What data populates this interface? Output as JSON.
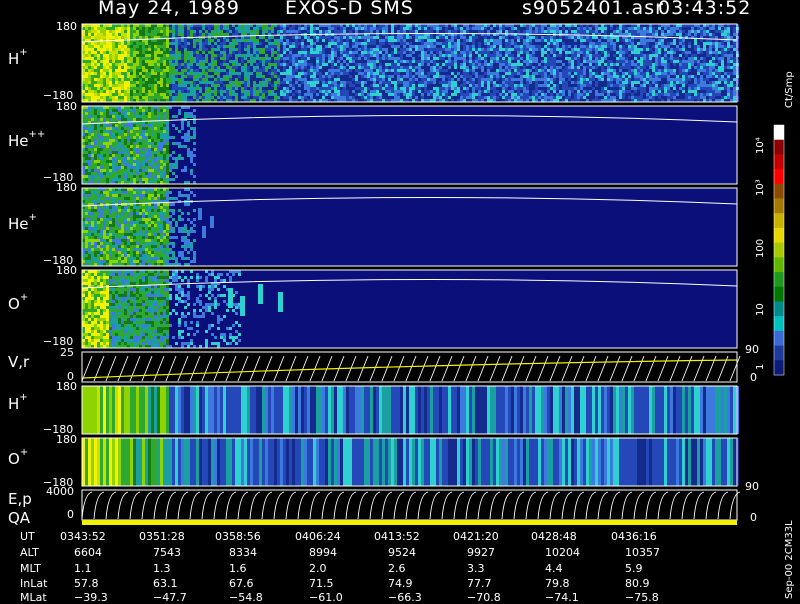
{
  "header": {
    "date": "May 24, 1989",
    "instrument": "EXOS-D SMS",
    "file": "s9052401.asr",
    "time": "03:43:52"
  },
  "panels": [
    {
      "id": "hplus",
      "species": "H",
      "charge": "+",
      "top_tick": "180",
      "bottom_tick": "−180"
    },
    {
      "id": "heplusplus",
      "species": "He",
      "charge": "++",
      "top_tick": "180",
      "bottom_tick": "−180"
    },
    {
      "id": "heplus",
      "species": "He",
      "charge": "+",
      "top_tick": "180",
      "bottom_tick": "−180"
    },
    {
      "id": "oplus",
      "species": "O",
      "charge": "+",
      "top_tick": "180",
      "bottom_tick": "−180"
    },
    {
      "id": "vr",
      "label": "V,r",
      "top_tick": "25",
      "bottom_tick": "0",
      "right_top": "90",
      "right_bottom": "0"
    },
    {
      "id": "hplus2",
      "species": "H",
      "charge": "+",
      "top_tick": "180",
      "bottom_tick": "−180"
    },
    {
      "id": "oplus2",
      "species": "O",
      "charge": "+",
      "top_tick": "180",
      "bottom_tick": "−180"
    },
    {
      "id": "ep",
      "label": "E,p",
      "label2": "QA",
      "top_tick": "4000",
      "bottom_tick": "0",
      "right_top": "90",
      "right_bottom": "0"
    }
  ],
  "colorbar": {
    "units": "Ct/Smp",
    "tick_labels": [
      "10⁴",
      "10³",
      "100",
      "10",
      "1"
    ],
    "colors": [
      "#ffffff",
      "#8b0000",
      "#c40000",
      "#ff0000",
      "#8b4a00",
      "#a67c00",
      "#c8b400",
      "#e6d800",
      "#a8c800",
      "#60b800",
      "#1e9a1e",
      "#007800",
      "#008a8a",
      "#00c0c0",
      "#3a6ad6",
      "#1e3a9a",
      "#0c1a78"
    ]
  },
  "footer": {
    "rows": [
      {
        "label": "UT",
        "values": [
          "0343:52",
          "0351:28",
          "0358:56",
          "0406:24",
          "0413:52",
          "0421:20",
          "0428:48",
          "0436:16"
        ]
      },
      {
        "label": "ALT",
        "values": [
          "6604",
          "7543",
          "8334",
          "8994",
          "9524",
          "9927",
          "10204",
          "10357"
        ]
      },
      {
        "label": "MLT",
        "values": [
          "1.1",
          "1.3",
          "1.6",
          "2.0",
          "2.6",
          "3.3",
          "4.4",
          "5.9"
        ]
      },
      {
        "label": "InLat",
        "values": [
          "57.8",
          "63.1",
          "67.6",
          "71.5",
          "74.9",
          "77.7",
          "79.8",
          "80.9"
        ]
      },
      {
        "label": "MLat",
        "values": [
          "−39.3",
          "−47.7",
          "−54.8",
          "−61.0",
          "−66.3",
          "−70.8",
          "−74.1",
          "−75.8"
        ]
      }
    ]
  },
  "version_label": "Sep-00 2CM33L",
  "chart_data": {
    "type": "heatmap",
    "title": "May 24, 1989   EXOS-D SMS",
    "x": [
      "0343:52",
      "0351:28",
      "0358:56",
      "0406:24",
      "0413:52",
      "0421:20",
      "0428:48",
      "0436:16"
    ],
    "panels": [
      "H+",
      "He++",
      "He+",
      "O+",
      "V,r",
      "H+",
      "O+",
      "E,p QA"
    ],
    "ylim": [
      -180,
      180
    ],
    "color_scale": "log",
    "color_range": [
      1,
      10000
    ],
    "colorbar_label": "Ct/Smp"
  }
}
